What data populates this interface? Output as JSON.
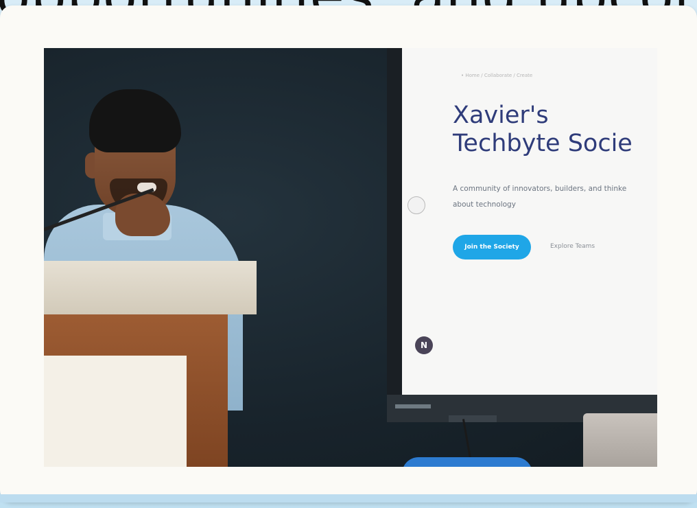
{
  "caption": {
    "text": "opportunities, and upcom"
  },
  "screen": {
    "breadcrumb": "• Home / Collaborate / Create",
    "title_line1": "Xavier's",
    "title_line2": "Techbyte Socie",
    "description_line1": "A community of innovators, builders, and thinke",
    "description_line2": "about technology",
    "primary_button": "Join the Society",
    "secondary_link": "Explore Teams",
    "badge_letter": "N"
  },
  "colors": {
    "title": "#2f3c7a",
    "button": "#1fa6e7",
    "background": "#bfe0f1"
  }
}
